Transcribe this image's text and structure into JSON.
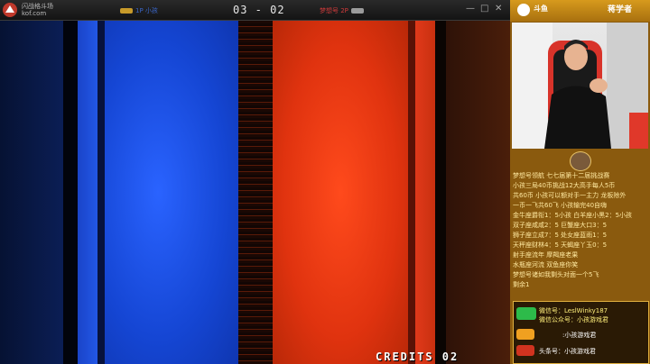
{
  "colors": {
    "accent": "#d7a01d",
    "blue_team": "#1f55e0",
    "red_team": "#e03a1a"
  },
  "header": {
    "logo_text": "闪战格斗场",
    "logo_url_text": "kof.com",
    "left_player": "1P 小孩",
    "right_player": "梦想号 2P",
    "score": "03 - 02",
    "minimize": "—",
    "maximize": "□",
    "close": "✕"
  },
  "game": {
    "credits": "CREDITS 02"
  },
  "sidebar": {
    "brand_left": "斗鱼",
    "brand_right": "蒋学者",
    "ticker": [
      "梦想号领航 七七届第十二届挑战赛",
      "小孩三局40币挑战12大高手每人5币",
      "共60币 小孩可以额对手一主力 龙板除外",
      "一币一飞共60飞 小孩输完40自嗨",
      "金牛座爵衔1：5小孩 白羊座小黑2：5小孩",
      "双子座咸咸2：5     巨蟹座大口3：5",
      "狮子座立成7：5     处女座蓝雨1：5",
      "天秤座财林4：5     天蝎座丫玉0：5",
      "射手座流年     摩羯座老果",
      "水瓶座河流     双鱼座你笑",
      "梦想号诸如我剩头对面一个5飞",
      "剩余1"
    ],
    "promo": {
      "wechat_label": "微信号：LeslWinky187",
      "wechat_public": "微信公众号：小孩游戏君",
      "douyu_label": ":小孩游戏君",
      "toutiao_label": "头条号：小孩游戏君"
    }
  }
}
